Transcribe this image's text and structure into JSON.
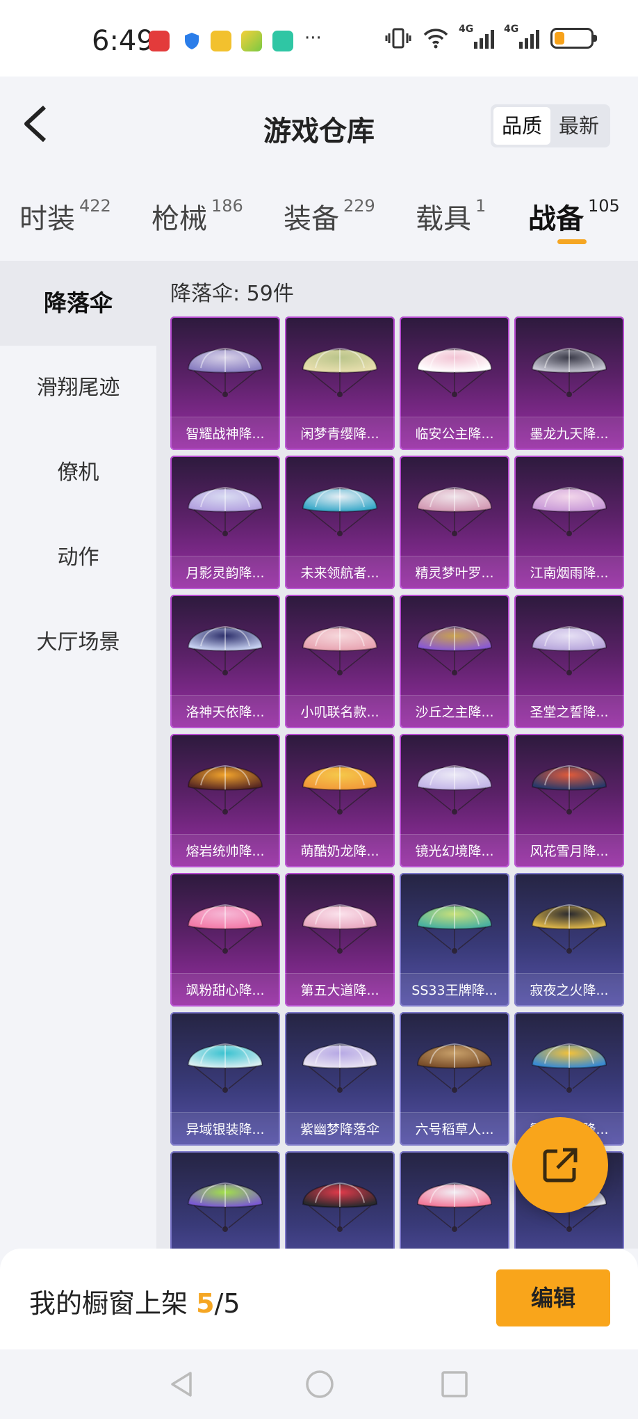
{
  "status_bar": {
    "time": "6:49",
    "battery_level": 0.2
  },
  "header": {
    "title": "游戏仓库",
    "sort_options": [
      "品质",
      "最新"
    ],
    "active_sort": "品质"
  },
  "tabs": [
    {
      "label": "时装",
      "count": "422"
    },
    {
      "label": "枪械",
      "count": "186"
    },
    {
      "label": "装备",
      "count": "229"
    },
    {
      "label": "载具",
      "count": "1"
    },
    {
      "label": "战备",
      "count": "105"
    }
  ],
  "active_tab": "战备",
  "sidebar": {
    "items": [
      "降落伞",
      "滑翔尾迹",
      "僚机",
      "动作",
      "大厅场景"
    ],
    "active": "降落伞"
  },
  "main": {
    "count_label": "降落伞: 59件"
  },
  "items": [
    {
      "name": "智耀战神降...",
      "rarity": "purple",
      "colors": [
        "#d8d2e8",
        "#8a7fc2"
      ]
    },
    {
      "name": "闲梦青缨降...",
      "rarity": "purple",
      "colors": [
        "#b9c48a",
        "#e8dfae"
      ]
    },
    {
      "name": "临安公主降...",
      "rarity": "purple",
      "colors": [
        "#f2c4d4",
        "#ffffff"
      ]
    },
    {
      "name": "墨龙九天降...",
      "rarity": "purple",
      "colors": [
        "#3a3a48",
        "#c8c8d4"
      ]
    },
    {
      "name": "月影灵韵降...",
      "rarity": "purple",
      "colors": [
        "#d9dcf2",
        "#b4a2e0"
      ]
    },
    {
      "name": "未来领航者...",
      "rarity": "purple",
      "colors": [
        "#e6eef4",
        "#3aa9c9"
      ]
    },
    {
      "name": "精灵梦叶罗...",
      "rarity": "purple",
      "colors": [
        "#f0e4ea",
        "#d39ab4"
      ]
    },
    {
      "name": "江南烟雨降...",
      "rarity": "purple",
      "colors": [
        "#f2d6ea",
        "#c99ad8"
      ]
    },
    {
      "name": "洛神天依降...",
      "rarity": "purple",
      "colors": [
        "#2c2e6a",
        "#c8d2f2"
      ]
    },
    {
      "name": "小叽联名款...",
      "rarity": "purple",
      "colors": [
        "#f6d8dc",
        "#e8a4b2"
      ]
    },
    {
      "name": "沙丘之主降...",
      "rarity": "purple",
      "colors": [
        "#c9a24e",
        "#8a5ad2"
      ]
    },
    {
      "name": "圣堂之誓降...",
      "rarity": "purple",
      "colors": [
        "#e6e0f4",
        "#b8a6dc"
      ]
    },
    {
      "name": "熔岩统帅降...",
      "rarity": "purple",
      "colors": [
        "#f2a42c",
        "#5a2a22"
      ]
    },
    {
      "name": "萌酷奶龙降...",
      "rarity": "purple",
      "colors": [
        "#f5c84a",
        "#f29a3a"
      ]
    },
    {
      "name": "镜光幻境降...",
      "rarity": "purple",
      "colors": [
        "#eceaf6",
        "#c4b6e8"
      ]
    },
    {
      "name": "风花雪月降...",
      "rarity": "purple",
      "colors": [
        "#e05a3a",
        "#2a3a6a"
      ]
    },
    {
      "name": "飒粉甜心降...",
      "rarity": "purple",
      "colors": [
        "#f6b8d6",
        "#f27aa8"
      ]
    },
    {
      "name": "第五大道降...",
      "rarity": "purple",
      "colors": [
        "#fbe2ec",
        "#e8a8c0"
      ]
    },
    {
      "name": "SS33王牌降...",
      "rarity": "blue",
      "colors": [
        "#c8e07a",
        "#4ab0a0"
      ]
    },
    {
      "name": "寂夜之火降...",
      "rarity": "blue",
      "colors": [
        "#2a2a2e",
        "#e0b84a"
      ]
    },
    {
      "name": "异域银装降...",
      "rarity": "blue",
      "colors": [
        "#3ac2d0",
        "#d8eef2"
      ]
    },
    {
      "name": "紫幽梦降落伞",
      "rarity": "blue",
      "colors": [
        "#b6a8e4",
        "#e8e2f2"
      ]
    },
    {
      "name": "六号稻草人...",
      "rarity": "blue",
      "colors": [
        "#c8a06a",
        "#7a4e2a"
      ]
    },
    {
      "name": "繁星之梦降...",
      "rarity": "blue",
      "colors": [
        "#f2c13a",
        "#3a8ad2"
      ]
    },
    {
      "name": "",
      "rarity": "blue",
      "colors": [
        "#a2e04a",
        "#7a5ad2"
      ]
    },
    {
      "name": "",
      "rarity": "blue",
      "colors": [
        "#e03a4a",
        "#2a2a2e"
      ]
    },
    {
      "name": "",
      "rarity": "blue",
      "colors": [
        "#f2eef4",
        "#f27a9a"
      ]
    },
    {
      "name": "",
      "rarity": "blue",
      "colors": [
        "#3a3a6a",
        "#e8e8f0"
      ]
    }
  ],
  "bottom": {
    "shelf_prefix": "我的橱窗上架 ",
    "shelf_current": "5",
    "shelf_total": "/5",
    "edit_label": "编辑"
  }
}
